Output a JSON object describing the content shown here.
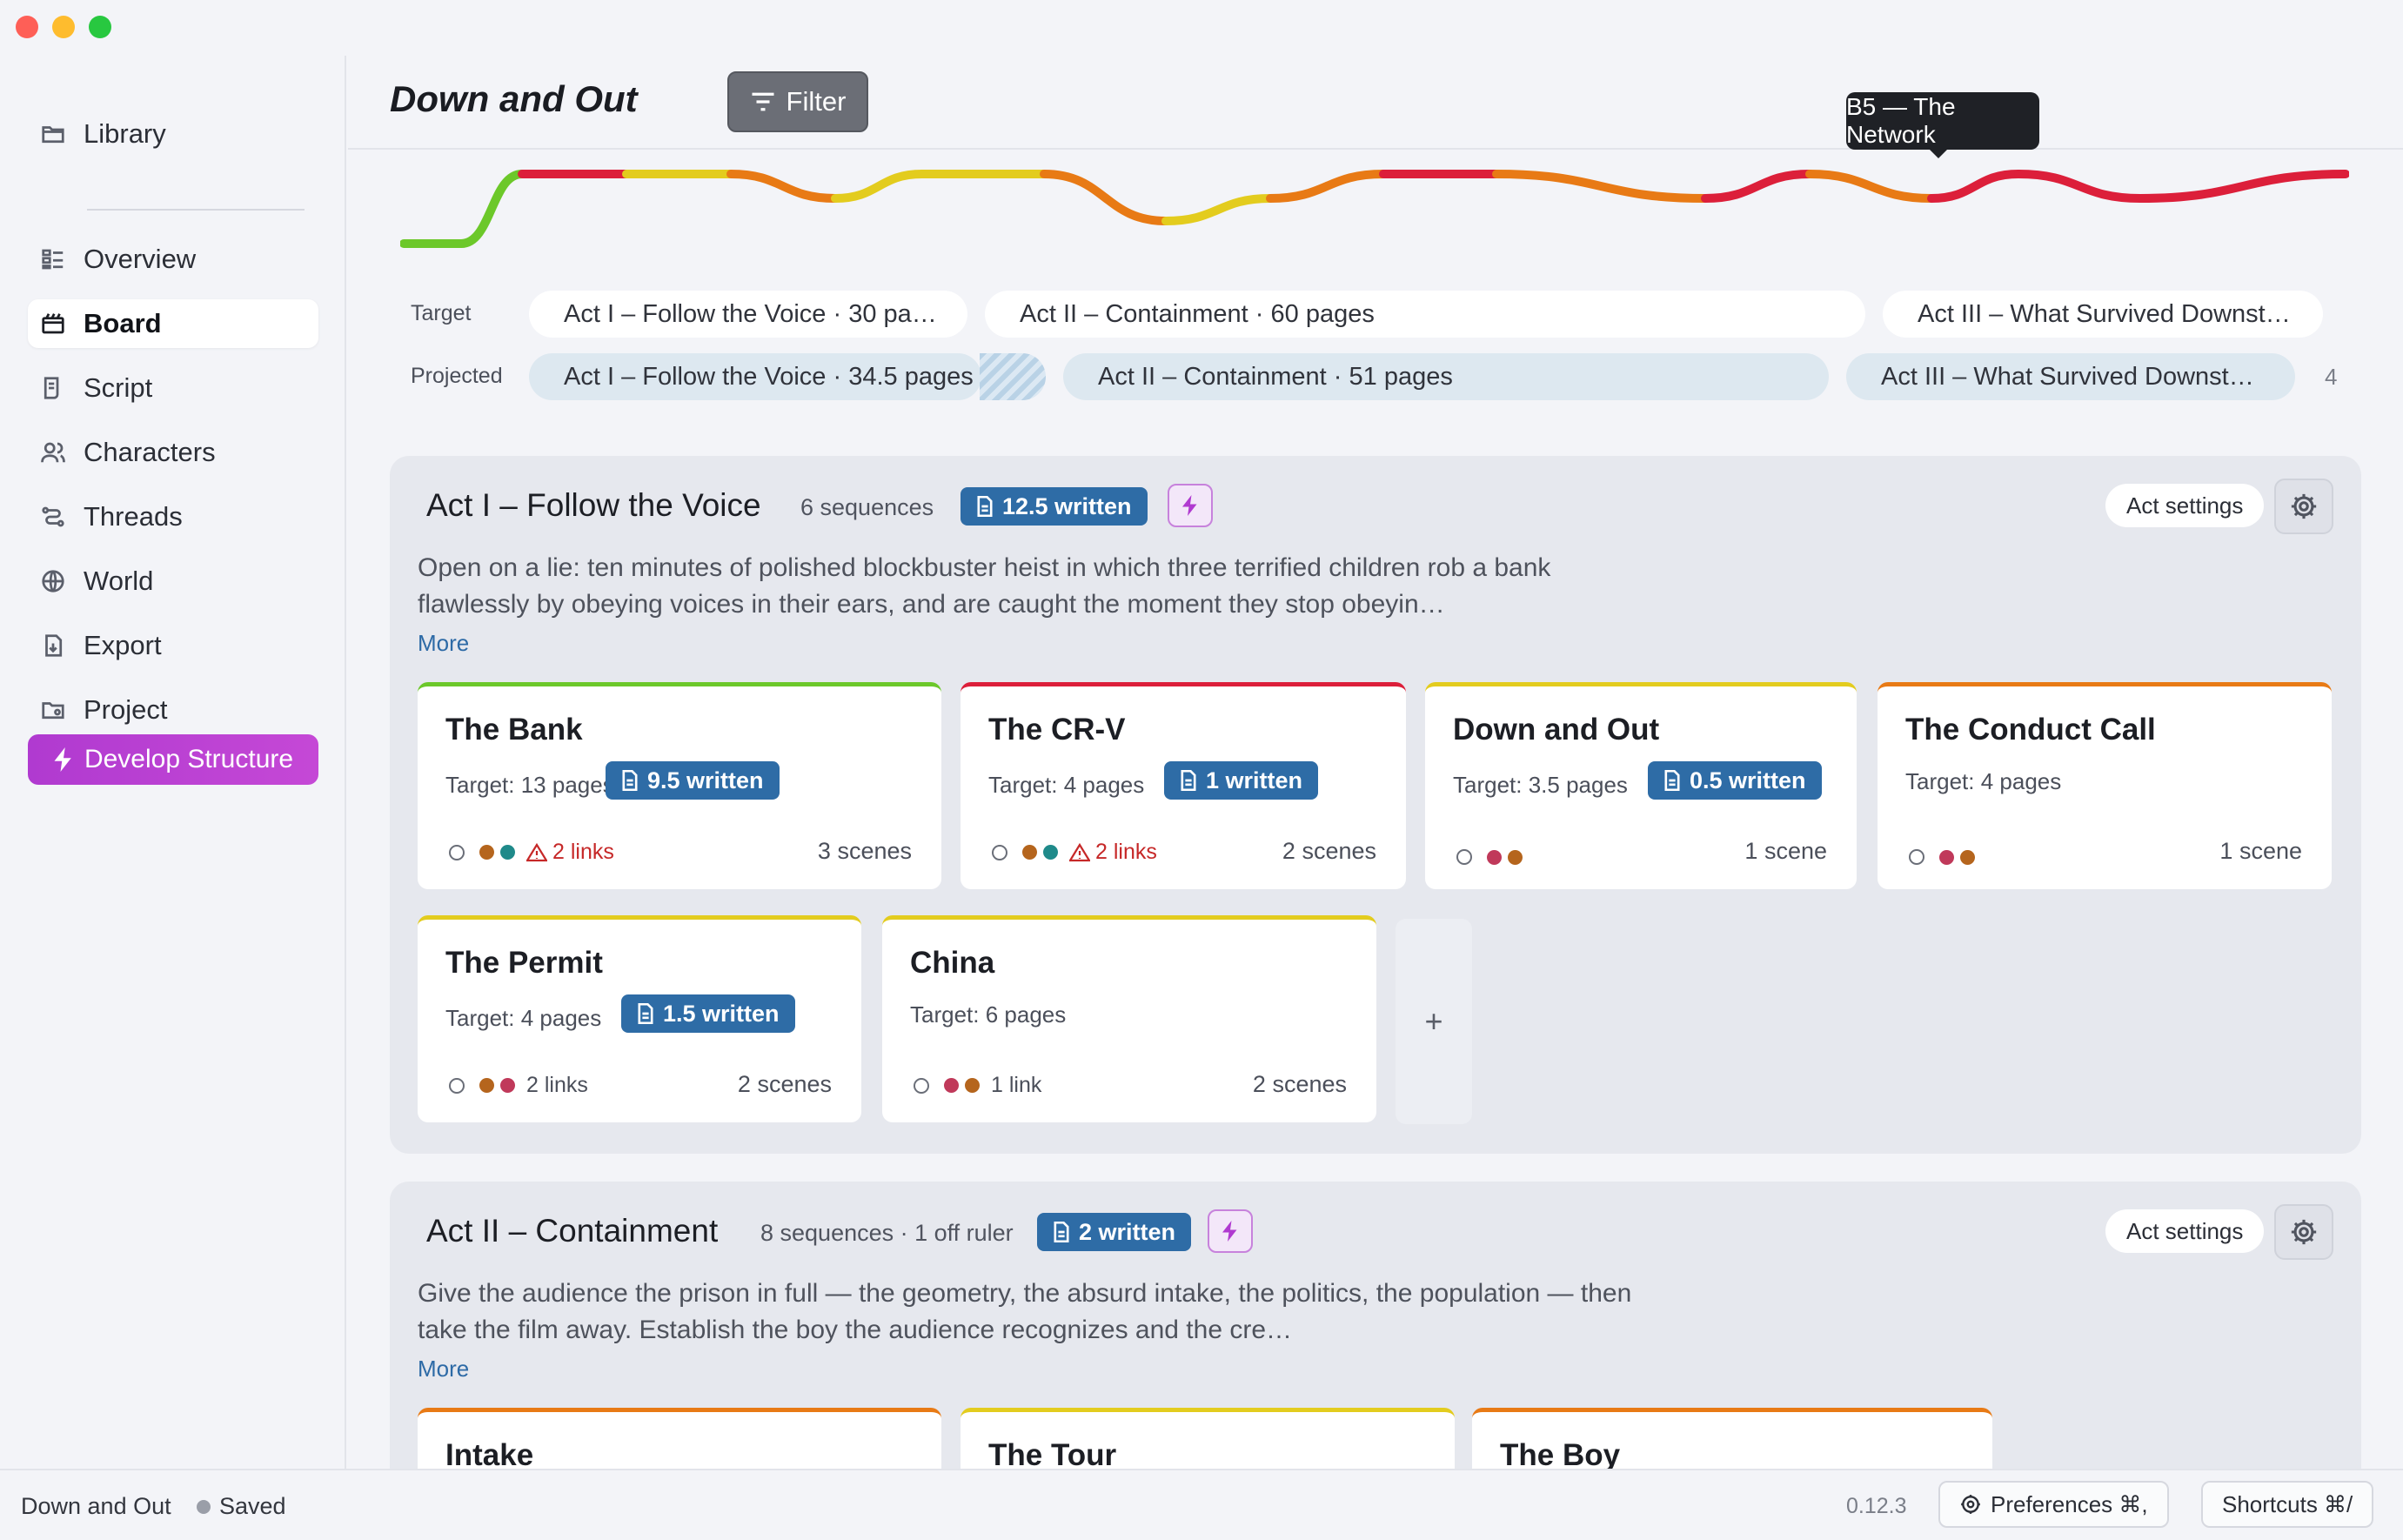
{
  "window": {
    "title": "Down and Out"
  },
  "sidebar": {
    "items": [
      {
        "label": "Library",
        "icon": "folder-icon"
      },
      {
        "label": "Overview",
        "icon": "overview-icon"
      },
      {
        "label": "Board",
        "icon": "board-icon",
        "active": true
      },
      {
        "label": "Script",
        "icon": "script-icon"
      },
      {
        "label": "Characters",
        "icon": "characters-icon"
      },
      {
        "label": "Threads",
        "icon": "threads-icon"
      },
      {
        "label": "World",
        "icon": "globe-icon"
      },
      {
        "label": "Export",
        "icon": "export-icon"
      },
      {
        "label": "Project",
        "icon": "project-icon"
      }
    ],
    "develop_label": "Develop Structure"
  },
  "header": {
    "title": "Down and Out",
    "filter_label": "Filter",
    "tooltip": "B5 — The Network"
  },
  "ruler": {
    "target_label": "Target",
    "projected_label": "Projected",
    "target": [
      "Act I – Follow the Voice · 30 pa…",
      "Act II – Containment · 60 pages",
      "Act III – What Survived Downst…"
    ],
    "projected": [
      "Act I – Follow the Voice · 34.5 pages (…",
      "Act II – Containment · 51 pages",
      "Act III – What Survived Downst…"
    ],
    "projected_count": "4"
  },
  "acts": [
    {
      "title": "Act I – Follow the Voice",
      "meta": "6 sequences",
      "written": "12.5 written",
      "settings_label": "Act settings",
      "description": "Open on a lie: ten minutes of polished blockbuster heist in which three terrified children rob a bank flawlessly by obeying voices in their ears, and are caught the moment they stop obeyin…",
      "more_label": "More",
      "cards": [
        {
          "title": "The Bank",
          "target": "Target: 13 pages",
          "written": "9.5 written",
          "links": "2 links",
          "links_warn": true,
          "scenes": "3 scenes",
          "color": "#6cc82a",
          "dots": [
            "#b5651d",
            "#1f8a8a"
          ]
        },
        {
          "title": "The CR-V",
          "target": "Target: 4 pages",
          "written": "1 written",
          "links": "2 links",
          "links_warn": true,
          "scenes": "2 scenes",
          "color": "#dc1f3a",
          "dots": [
            "#b5651d",
            "#1f8a8a"
          ]
        },
        {
          "title": "Down and Out",
          "target": "Target: 3.5 pages",
          "written": "0.5 written",
          "links": "",
          "links_warn": false,
          "scenes": "1 scene",
          "color": "#e3cc1e",
          "dots": [
            "#c0395a",
            "#b5651d"
          ]
        },
        {
          "title": "The Conduct Call",
          "target": "Target: 4 pages",
          "written": "",
          "links": "",
          "links_warn": false,
          "scenes": "1 scene",
          "color": "#e87a15",
          "dots": [
            "#c0395a",
            "#b5651d"
          ]
        },
        {
          "title": "The Permit",
          "target": "Target: 4 pages",
          "written": "1.5 written",
          "links": "2 links",
          "links_warn": false,
          "scenes": "2 scenes",
          "color": "#e3cc1e",
          "dots": [
            "#b5651d",
            "#c0395a"
          ]
        },
        {
          "title": "China",
          "target": "Target: 6 pages",
          "written": "",
          "links": "1 link",
          "links_warn": false,
          "scenes": "2 scenes",
          "color": "#e3cc1e",
          "dots": [
            "#c0395a",
            "#b5651d"
          ]
        }
      ],
      "add_label": "+"
    },
    {
      "title": "Act II – Containment",
      "meta": "8 sequences · 1 off ruler",
      "written": "2 written",
      "settings_label": "Act settings",
      "description": "Give the audience the prison in full — the geometry, the absurd intake, the politics, the population — then take the film away. Establish the boy the audience recognizes and the cre…",
      "more_label": "More",
      "cards": [
        {
          "title": "Intake",
          "color": "#e87a15"
        },
        {
          "title": "The Tour",
          "color": "#e3cc1e"
        },
        {
          "title": "The Boy",
          "color": "#e87a15"
        }
      ]
    }
  ],
  "statusbar": {
    "project": "Down and Out",
    "saved": "Saved",
    "version": "0.12.3",
    "preferences": "Preferences ⌘,",
    "shortcuts": "Shortcuts ⌘/"
  },
  "colors": {
    "accent": "#2e6ca6",
    "develop": "#b03ad0",
    "tension_green": "#6cc82a",
    "tension_yellow": "#e3cc1e",
    "tension_orange": "#e87a15",
    "tension_red": "#dc1f3a"
  }
}
